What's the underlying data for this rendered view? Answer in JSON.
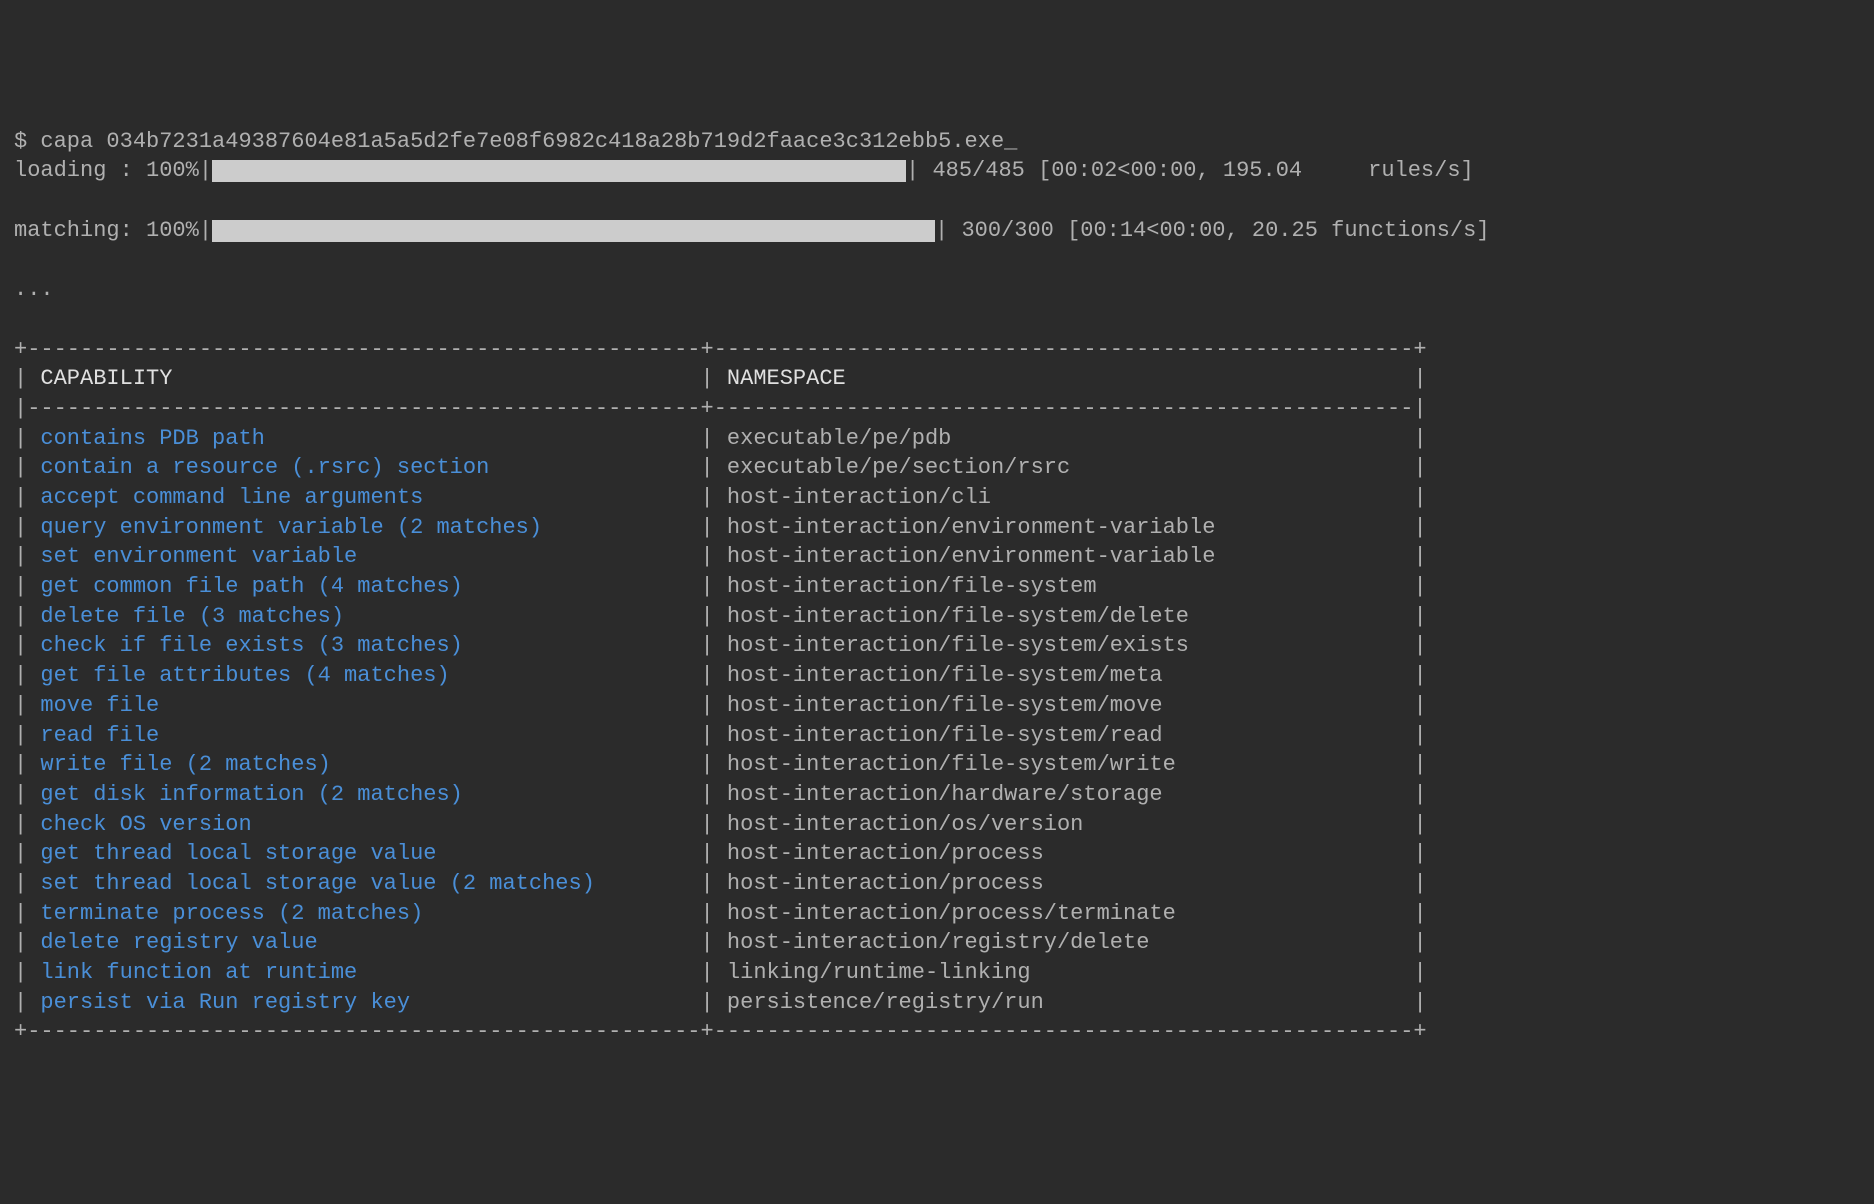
{
  "command": {
    "prompt": "$ ",
    "cmd": "capa 034b7231a49387604e81a5a5d2fe7e08f6982c418a28b719d2faace3c312ebb5.exe",
    "cursor": "_"
  },
  "progress": {
    "loading": {
      "label": "loading : 100%|",
      "stats": "| 485/485 [00:02<00:00, 195.04     rules/s]"
    },
    "matching": {
      "label": "matching: 100%|",
      "stats": "| 300/300 [00:14<00:00, 20.25 functions/s]"
    }
  },
  "ellipsis": "...",
  "table": {
    "headers": {
      "capability": "CAPABILITY",
      "namespace": "NAMESPACE"
    },
    "border_top": "+---------------------------------------------------+-----------------------------------------------------+",
    "border_mid": "|---------------------------------------------------+-----------------------------------------------------|",
    "border_bot": "+---------------------------------------------------+-----------------------------------------------------+",
    "rows": [
      {
        "capability": "contains PDB path",
        "namespace": "executable/pe/pdb"
      },
      {
        "capability": "contain a resource (.rsrc) section",
        "namespace": "executable/pe/section/rsrc"
      },
      {
        "capability": "accept command line arguments",
        "namespace": "host-interaction/cli"
      },
      {
        "capability": "query environment variable (2 matches)",
        "namespace": "host-interaction/environment-variable"
      },
      {
        "capability": "set environment variable",
        "namespace": "host-interaction/environment-variable"
      },
      {
        "capability": "get common file path (4 matches)",
        "namespace": "host-interaction/file-system"
      },
      {
        "capability": "delete file (3 matches)",
        "namespace": "host-interaction/file-system/delete"
      },
      {
        "capability": "check if file exists (3 matches)",
        "namespace": "host-interaction/file-system/exists"
      },
      {
        "capability": "get file attributes (4 matches)",
        "namespace": "host-interaction/file-system/meta"
      },
      {
        "capability": "move file",
        "namespace": "host-interaction/file-system/move"
      },
      {
        "capability": "read file",
        "namespace": "host-interaction/file-system/read"
      },
      {
        "capability": "write file (2 matches)",
        "namespace": "host-interaction/file-system/write"
      },
      {
        "capability": "get disk information (2 matches)",
        "namespace": "host-interaction/hardware/storage"
      },
      {
        "capability": "check OS version",
        "namespace": "host-interaction/os/version"
      },
      {
        "capability": "get thread local storage value",
        "namespace": "host-interaction/process"
      },
      {
        "capability": "set thread local storage value (2 matches)",
        "namespace": "host-interaction/process"
      },
      {
        "capability": "terminate process (2 matches)",
        "namespace": "host-interaction/process/terminate"
      },
      {
        "capability": "delete registry value",
        "namespace": "host-interaction/registry/delete"
      },
      {
        "capability": "link function at runtime",
        "namespace": "linking/runtime-linking"
      },
      {
        "capability": "persist via Run registry key",
        "namespace": "persistence/registry/run"
      }
    ]
  }
}
